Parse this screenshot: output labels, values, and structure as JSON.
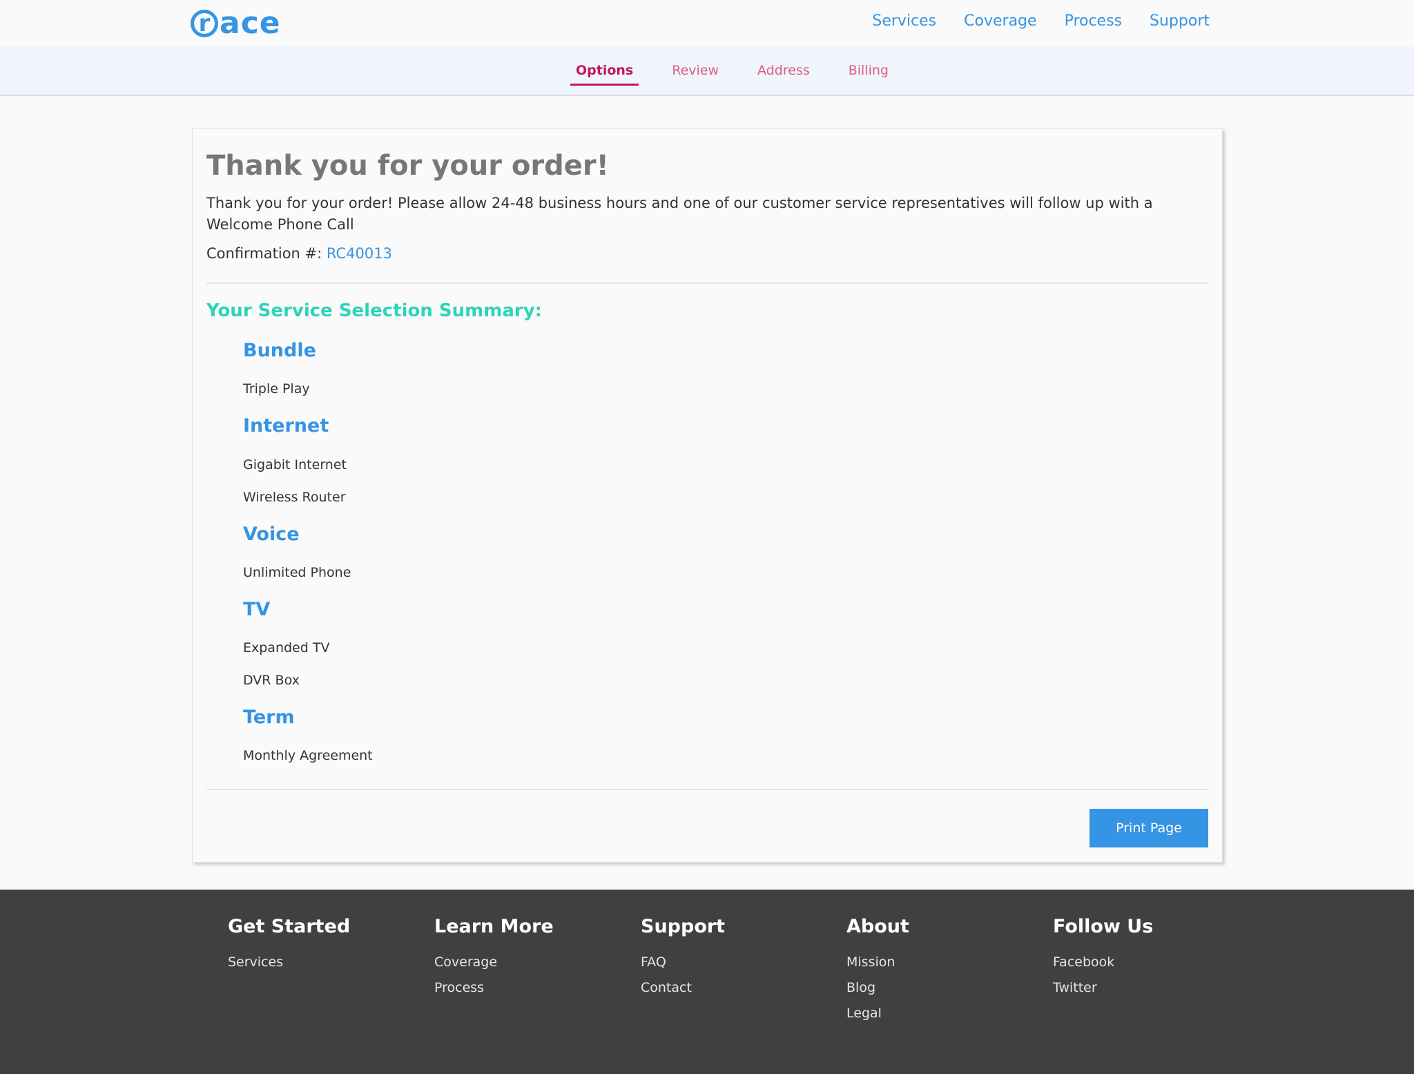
{
  "brand": {
    "logo_mark": "r",
    "logo_text": "ace"
  },
  "main_nav": [
    {
      "label": "Services"
    },
    {
      "label": "Coverage"
    },
    {
      "label": "Process"
    },
    {
      "label": "Support"
    }
  ],
  "steps": [
    {
      "label": "Options",
      "active": true
    },
    {
      "label": "Review",
      "active": false
    },
    {
      "label": "Address",
      "active": false
    },
    {
      "label": "Billing",
      "active": false
    }
  ],
  "order": {
    "title": "Thank you for your order!",
    "message": "Thank you for your order! Please allow 24-48 business hours and one of our customer service representatives will follow up with a Welcome Phone Call",
    "confirmation_label": "Confirmation #:",
    "confirmation_number": "RC40013"
  },
  "summary": {
    "heading": "Your Service Selection Summary:",
    "categories": [
      {
        "name": "Bundle",
        "items": [
          "Triple Play"
        ]
      },
      {
        "name": "Internet",
        "items": [
          "Gigabit Internet",
          "Wireless Router"
        ]
      },
      {
        "name": "Voice",
        "items": [
          "Unlimited Phone"
        ]
      },
      {
        "name": "TV",
        "items": [
          "Expanded TV",
          "DVR Box"
        ]
      },
      {
        "name": "Term",
        "items": [
          "Monthly Agreement"
        ]
      }
    ]
  },
  "actions": {
    "print_label": "Print Page"
  },
  "footer": {
    "columns": [
      {
        "heading": "Get Started",
        "links": [
          "Services"
        ]
      },
      {
        "heading": "Learn More",
        "links": [
          "Coverage",
          "Process"
        ]
      },
      {
        "heading": "Support",
        "links": [
          "FAQ",
          "Contact"
        ]
      },
      {
        "heading": "About",
        "links": [
          "Mission",
          "Blog",
          "Legal"
        ]
      },
      {
        "heading": "Follow Us",
        "links": [
          "Facebook",
          "Twitter"
        ]
      }
    ]
  },
  "colors": {
    "brand_blue": "#3594e3",
    "step_pink": "#e05a7e",
    "step_active": "#c2185b",
    "summary_teal": "#2ed3b7",
    "footer_bg": "#404040"
  }
}
